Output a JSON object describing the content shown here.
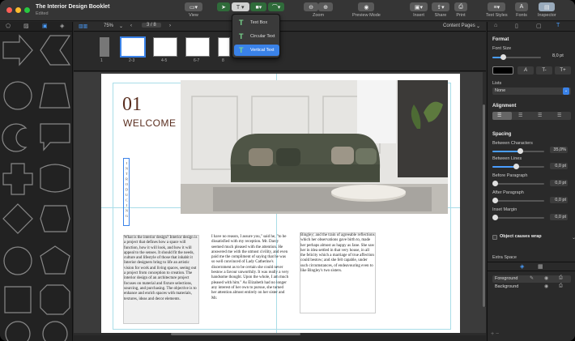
{
  "window": {
    "title": "The Interior Design Booklet",
    "subtitle": "Edited"
  },
  "toolbar": {
    "view_label": "View",
    "zoom_label": "Zoom",
    "preview_label": "Preview Mode",
    "insert_label": "Insert",
    "share_label": "Share",
    "print_label": "Print",
    "text_styles_label": "Text Styles",
    "fonts_label": "Fonts",
    "inspector_label": "Inspector",
    "fonts_button_glyph": "A"
  },
  "text_menu": {
    "items": [
      {
        "label": "Text Box",
        "icon": "text-icon"
      },
      {
        "label": "Circular Text",
        "icon": "circular-text-icon"
      },
      {
        "label": "Vertical Text",
        "icon": "vertical-text-icon"
      }
    ],
    "selected": "Vertical Text"
  },
  "secondary_bar": {
    "zoom": "75%",
    "page_indicator": "3 / 8",
    "content_mode": "Content Pages"
  },
  "thumbnails": [
    "1",
    "2-3",
    "4-5",
    "6-7",
    "8"
  ],
  "page": {
    "number": "01",
    "heading": "WELCOME",
    "vertical_text": "INTRODUCING",
    "column1": "What is the interior design? Interior design is a project that defines how a space will function, how it will look, and how it will appeal to the senses. It should fit the needs, culture and lifestyle of those that inhabit it Interior designers bring to life an artistic vision for work and living spaces, seeing out a project from conception to creation. The interior design of an architecture project focuses on material and fixture selections, sourcing, and purchasing. The objective is to enhance and enrich spaces with materials, textures, ideas and decor elements.",
    "column2": "I have no reason, I assure you,\" said he, \"to be dissatisfied with my reception. Mr. Darcy seemed much pleased with the attention. He answered me with the utmost civility, and even paid me the compliment of saying that he was so well convinced of Lady Catherine's discernment as to be certain she could never bestow a favour unworthily. It was really a very handsome thought. Upon the whole, I am much pleased with him.\" As Elizabeth had no longer any interest of her own to pursue, she turned her attention almost entirely on her sister and Mr.",
    "column3": "Bingley; and the train of agreeable reflections which her observations gave birth to, made her perhaps almost as happy as Jane. She saw her in idea settled in that very house, in all the felicity which a marriage of true affection could bestow; and she felt capable, under such circumstances, of endeavouring even to like Bingley's two sisters."
  },
  "inspector": {
    "format_heading": "Format",
    "font_size_label": "Font Size",
    "font_size_value": "8,0 pt",
    "lists_label": "Lists",
    "lists_value": "None",
    "alignment_label": "Alignment",
    "spacing_label": "Spacing",
    "between_chars_label": "Between Characters",
    "between_chars_value": "35,0%",
    "between_lines_label": "Between Lines",
    "between_lines_value": "0,0 pt",
    "before_para_label": "Before Paragraph",
    "before_para_value": "0,0 pt",
    "after_para_label": "After Paragraph",
    "after_para_value": "0,0 pt",
    "inset_margin_label": "Inset Margin",
    "inset_margin_value": "0,0 pt",
    "wrap_label": "Object causes wrap",
    "extra_space_label": "Extra Space",
    "fg_label": "Foreground",
    "bg_label": "Background",
    "style_buttons": [
      "A",
      "T-",
      "T+"
    ]
  },
  "colors": {
    "accent": "#3a82e8",
    "page_number": "#5a2e1f"
  }
}
